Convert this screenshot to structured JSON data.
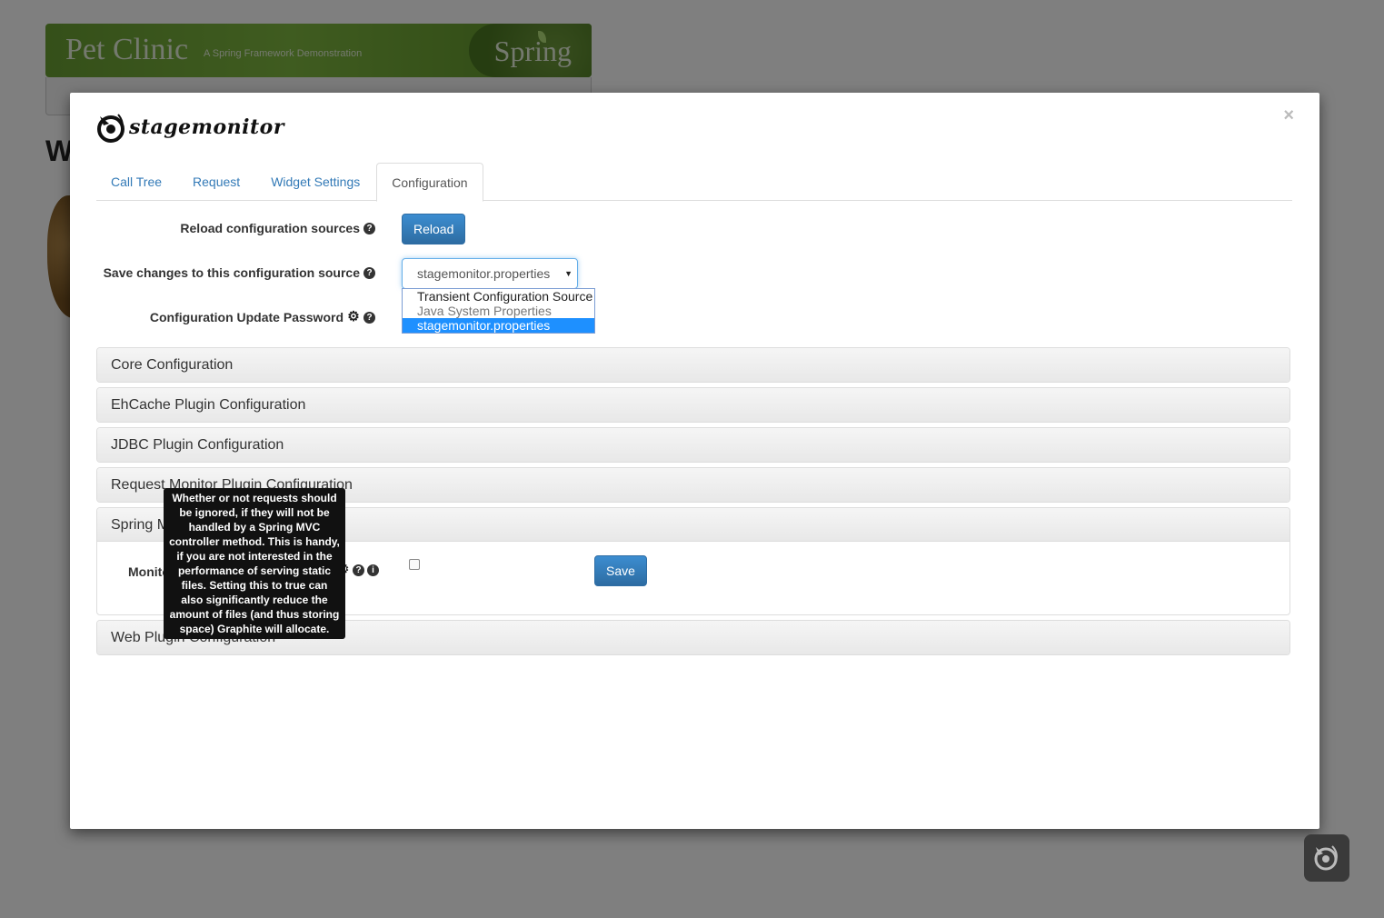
{
  "background_page": {
    "banner_title": "Pet Clinic",
    "banner_subtitle": "A Spring Framework Demonstration",
    "banner_brand": "Spring",
    "heading_partial": "W"
  },
  "modal": {
    "close_label": "×",
    "logo_text": "stagemonitor",
    "tabs": [
      {
        "label": "Call Tree",
        "active": false
      },
      {
        "label": "Request",
        "active": false
      },
      {
        "label": "Widget Settings",
        "active": false
      },
      {
        "label": "Configuration",
        "active": true
      }
    ],
    "reload_row": {
      "label": "Reload configuration sources",
      "button_label": "Reload"
    },
    "save_source_row": {
      "label": "Save changes to this configuration source",
      "selected_value": "stagemonitor.properties",
      "options": [
        {
          "label": "Transient Configuration Source",
          "state": "normal"
        },
        {
          "label": "Java System Properties",
          "state": "muted"
        },
        {
          "label": "stagemonitor.properties",
          "state": "selected"
        }
      ]
    },
    "password_row": {
      "label": "Configuration Update Password"
    },
    "panels": [
      {
        "title": "Core Configuration"
      },
      {
        "title": "EhCache Plugin Configuration"
      },
      {
        "title": "JDBC Plugin Configuration"
      },
      {
        "title": "Request Monitor Plugin Configuration"
      },
      {
        "title": "Spring MVC Plugin Configuration"
      },
      {
        "title": "Web Plugin Configuration"
      }
    ],
    "spring_mvc_body": {
      "field_label": "Monitor only Spring MVC requests",
      "checked": false,
      "save_label": "Save"
    },
    "tooltip_text": "Whether or not requests should be ignored, if they will not be handled by a Spring MVC controller method. This is handy, if you are not interested in the performance of serving static files. Setting this to true can also significantly reduce the amount of files (and thus storing space) Graphite will allocate."
  },
  "colors": {
    "primary": "#337ab7",
    "link": "#337ab7",
    "dropdown_selected": "#1e90ff",
    "banner_green": "#6aa033",
    "tooltip_bg": "#111111"
  },
  "icons": {
    "help": "question-circle-icon",
    "settings": "gear-icon",
    "info": "info-circle-icon",
    "close": "close-icon"
  }
}
